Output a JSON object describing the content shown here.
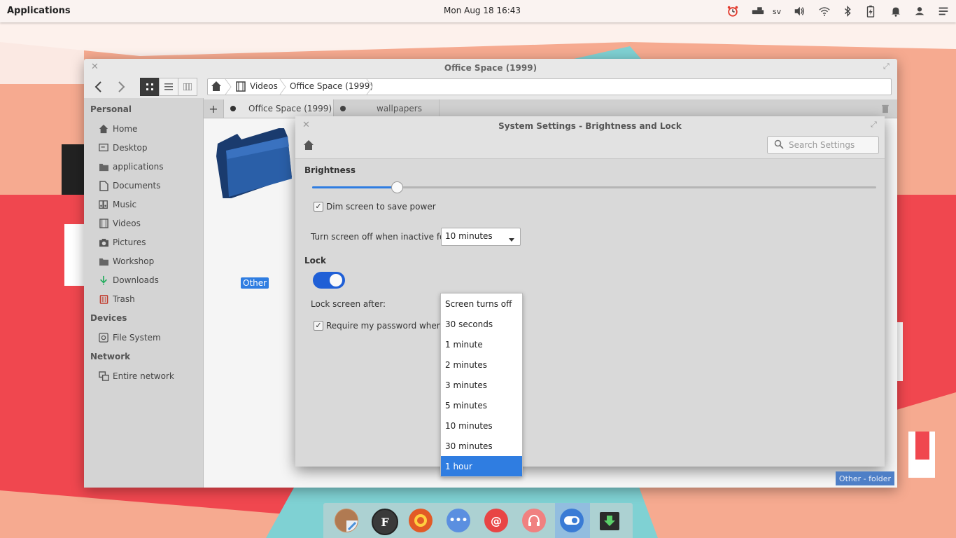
{
  "panel": {
    "applications_label": "Applications",
    "clock": "Mon Aug 18 16:43",
    "keyboard_layout": "sv",
    "indicators": [
      "alarm-clock-icon",
      "keyboard-icon",
      "volume-icon",
      "wifi-icon",
      "bluetooth-icon",
      "battery-icon",
      "notifications-icon",
      "user-icon",
      "menu-icon"
    ]
  },
  "file_manager": {
    "title": "Office Space (1999)",
    "breadcrumb": [
      "Videos",
      "Office Space (1999)"
    ],
    "sidebar": {
      "personal_heading": "Personal",
      "personal_items": [
        {
          "label": "Home",
          "icon": "home-icon"
        },
        {
          "label": "Desktop",
          "icon": "desktop-icon"
        },
        {
          "label": "applications",
          "icon": "folder-icon"
        },
        {
          "label": "Documents",
          "icon": "document-icon"
        },
        {
          "label": "Music",
          "icon": "music-icon"
        },
        {
          "label": "Videos",
          "icon": "film-icon"
        },
        {
          "label": "Pictures",
          "icon": "camera-icon"
        },
        {
          "label": "Workshop",
          "icon": "folder-icon"
        },
        {
          "label": "Downloads",
          "icon": "download-icon"
        },
        {
          "label": "Trash",
          "icon": "trash-icon"
        }
      ],
      "devices_heading": "Devices",
      "device_items": [
        {
          "label": "File System",
          "icon": "drive-icon"
        }
      ],
      "network_heading": "Network",
      "network_items": [
        {
          "label": "Entire network",
          "icon": "network-icon"
        }
      ]
    },
    "tabs": [
      {
        "label": "Office Space (1999)"
      },
      {
        "label": "wallpapers"
      }
    ],
    "folder": {
      "name": "Other"
    },
    "status": "Other - folder"
  },
  "settings": {
    "title": "System Settings - Brightness and Lock",
    "search_placeholder": "Search Settings",
    "brightness_heading": "Brightness",
    "brightness_level": 0.15,
    "dim_label": "Dim screen to save power",
    "dim_checked": true,
    "screen_off_label": "Turn screen off when inactive for:",
    "screen_off_value": "10 minutes",
    "lock_heading": "Lock",
    "lock_enabled": true,
    "lock_after_label": "Lock screen after:",
    "require_password_label": "Require my password when wa",
    "require_password_checked": true,
    "lock_options": [
      "Screen turns off",
      "30 seconds",
      "1 minute",
      "2 minutes",
      "3 minutes",
      "5 minutes",
      "10 minutes",
      "30 minutes",
      "1 hour"
    ],
    "selected_option": "1 hour"
  },
  "dock": {
    "apps": [
      "shotwell-icon",
      "files-icon",
      "firefox-icon",
      "chat-icon",
      "mail-icon",
      "music-icon",
      "settings-icon",
      "installer-icon"
    ]
  },
  "colors": {
    "accent": "#2f7de1",
    "switch": "#1f5fd6"
  }
}
